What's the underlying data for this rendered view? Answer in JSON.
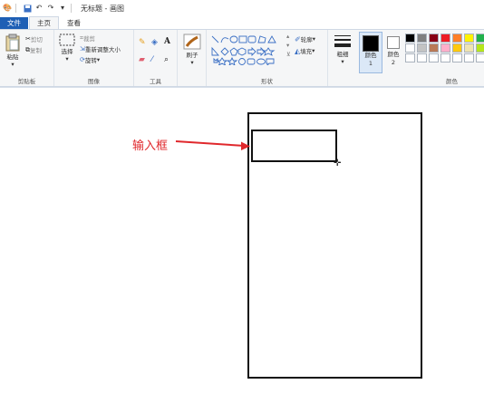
{
  "window": {
    "title": "无标题 - 画图"
  },
  "tabs": [
    {
      "label": "文件"
    },
    {
      "label": "主页"
    },
    {
      "label": "查看"
    }
  ],
  "ribbon": {
    "clipboard": {
      "paste": "粘贴",
      "cut": "剪切",
      "copy": "复制",
      "label": "剪贴板"
    },
    "image": {
      "select": "选择",
      "crop": "裁剪",
      "resize": "重新调整大小",
      "rotate": "旋转",
      "label": "图像"
    },
    "tools": {
      "label": "工具",
      "text_tool": "A"
    },
    "brushes": {
      "label": "刷子"
    },
    "shapes": {
      "outline": "轮廓",
      "fill": "填充",
      "label": "形状"
    },
    "size": {
      "label": "粗细"
    },
    "colors": {
      "color1": "颜色 1",
      "color2": "颜色 2",
      "label": "颜色",
      "color1_value": "#000000",
      "color2_value": "#ffffff",
      "palette": [
        "#000000",
        "#7f7f7f",
        "#880015",
        "#ed1c24",
        "#ff7f27",
        "#fff200",
        "#22b14c",
        "#ffffff",
        "#c3c3c3",
        "#b97a57",
        "#ffaec9",
        "#ffc90e",
        "#efe4b0",
        "#b5e61d",
        "#ffffff",
        "#ffffff",
        "#ffffff",
        "#ffffff",
        "#ffffff",
        "#ffffff",
        "#ffffff"
      ]
    }
  },
  "canvas": {
    "annotation": "输入框",
    "annotation_color": "#e0282c"
  }
}
